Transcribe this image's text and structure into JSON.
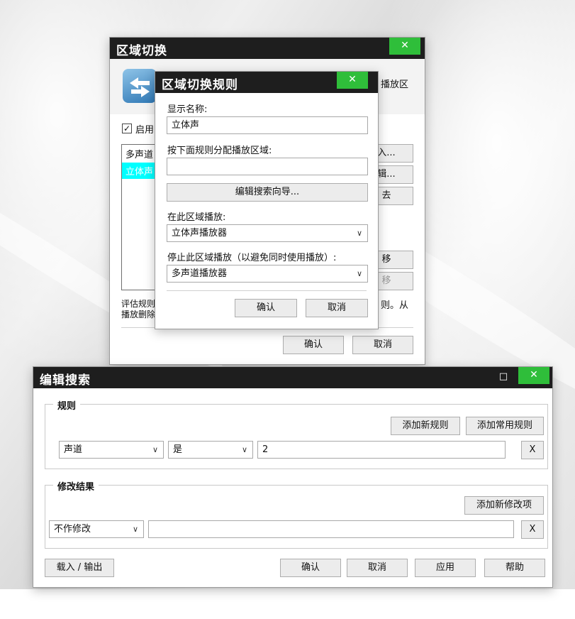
{
  "zone_window": {
    "title": "区域切换",
    "close_icon": "✕",
    "header_desc": "播放区",
    "enable_checkbox_label": "启用",
    "list_items": [
      "多声道",
      "立体声"
    ],
    "btn_import": "入...",
    "btn_edit": "辑...",
    "btn_delete": "去",
    "btn_up": "移",
    "btn_down": "移",
    "footer_text_line1": "评估规则",
    "footer_text_line2": "播放删除",
    "footer_text_right": "则。从",
    "ok": "确认",
    "cancel": "取消"
  },
  "rule_dialog": {
    "title": "区域切换规则",
    "close_icon": "✕",
    "display_name_label": "显示名称:",
    "display_name_value": "立体声",
    "assign_rule_label": "按下面规则分配播放区域:",
    "assign_rule_value": "",
    "search_wizard_button": "编辑搜索向导...",
    "play_zone_label": "在此区域播放:",
    "play_zone_value": "立体声播放器",
    "stop_zone_label": "停止此区域播放（以避免同时使用播放）:",
    "stop_zone_value": "多声道播放器",
    "ok": "确认",
    "cancel": "取消"
  },
  "search_window": {
    "title": "编辑搜索",
    "maximize_icon": "□",
    "close_icon": "✕",
    "rules_group_label": "规则",
    "add_new_rule": "添加新规则",
    "add_common_rule": "添加常用规则",
    "rule_field_value": "声道",
    "rule_operator_value": "是",
    "rule_value": "2",
    "remove_rule": "X",
    "modify_group_label": "修改结果",
    "add_modify_item": "添加新修改项",
    "modify_action_value": "不作修改",
    "modify_value": "",
    "remove_modify": "X",
    "load_save": "载入 / 输出",
    "ok": "确认",
    "cancel": "取消",
    "apply": "应用",
    "help": "帮助"
  },
  "icons": {
    "checkbox": "checkmark-icon",
    "switch_arrows": "switch-arrows-icon",
    "dropdown": "chevron-down-icon"
  },
  "colors": {
    "titlebar": "#1e1e1e",
    "close_button": "#2fbe3a",
    "list_selection": "#00ffff"
  }
}
